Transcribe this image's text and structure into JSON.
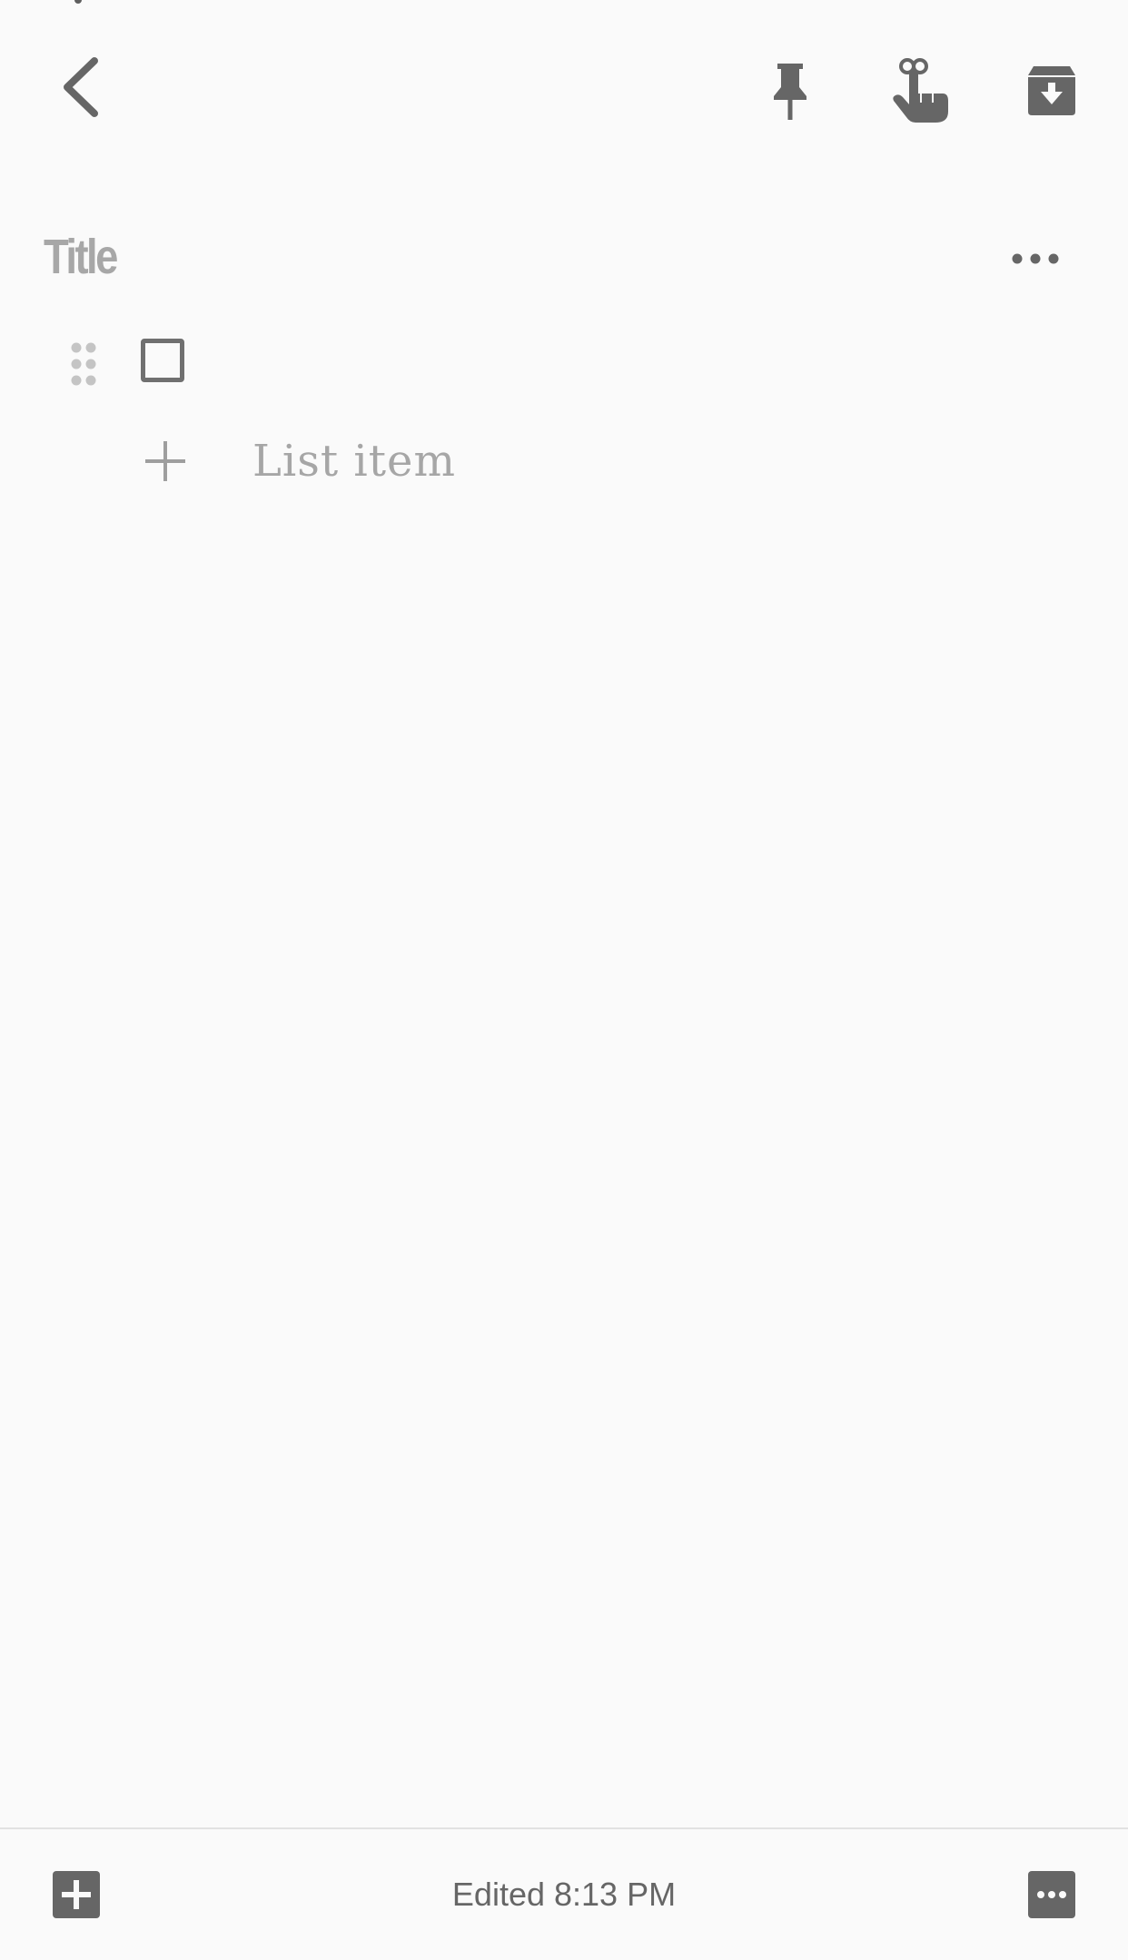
{
  "toolbar": {
    "back_icon": "chevron-left-icon",
    "pin_icon": "pushpin-icon",
    "reminder_icon": "finger-reminder-icon",
    "archive_icon": "archive-icon"
  },
  "note": {
    "title_placeholder": "Title",
    "more_icon": "more-horizontal-icon",
    "items": [
      {
        "checked": false,
        "text": ""
      }
    ],
    "add_item_label": "List item"
  },
  "bottom_bar": {
    "add_icon": "add-box-icon",
    "edited_label": "Edited 8:13 PM",
    "more_icon": "more-box-icon"
  },
  "colors": {
    "background": "#fafafa",
    "icon": "#616161",
    "placeholder": "#a7a7a7"
  }
}
